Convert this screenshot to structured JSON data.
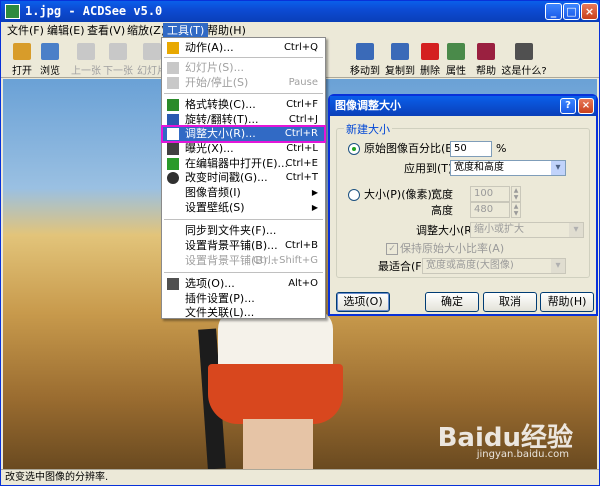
{
  "window": {
    "title": "1.jpg - ACDSee v5.0",
    "buttons": {
      "minimize": "_",
      "maximize": "□",
      "close": "×"
    }
  },
  "menubar": {
    "items": [
      {
        "label": "文件(F)"
      },
      {
        "label": "编辑(E)"
      },
      {
        "label": "查看(V)"
      },
      {
        "label": "缩放(Z)"
      },
      {
        "label": "工具(T)"
      },
      {
        "label": "帮助(H)"
      }
    ]
  },
  "toolbar": {
    "items": [
      {
        "label": "打开",
        "icon": "open-folder-icon",
        "color": "#d89c2a"
      },
      {
        "label": "浏览",
        "icon": "browse-icon",
        "color": "#4a7fc8"
      },
      {
        "label": "上一张",
        "icon": "prev-icon"
      },
      {
        "label": "下一张",
        "icon": "next-icon"
      },
      {
        "label": "幻灯片",
        "icon": "slideshow-icon"
      },
      {
        "label": "移动到",
        "icon": "move-to-icon",
        "color": "#3a6ab8"
      },
      {
        "label": "复制到",
        "icon": "copy-to-icon",
        "color": "#3a6ab8"
      },
      {
        "label": "删除",
        "icon": "delete-icon",
        "color": "#d42020"
      },
      {
        "label": "属性",
        "icon": "properties-icon",
        "color": "#4a8a4a"
      },
      {
        "label": "帮助",
        "icon": "help-book-icon",
        "color": "#9a2040"
      },
      {
        "label": "这是什么?",
        "icon": "whats-this-icon",
        "color": "#505050"
      }
    ]
  },
  "tools_menu": {
    "items": [
      {
        "label": "动作(A)...",
        "shortcut": "Ctrl+Q",
        "icon": "lightning-icon",
        "color": "#e8a800"
      },
      {
        "label": "幻灯片(S)...",
        "shortcut": "",
        "icon": "slideshow-icon",
        "disabled": true
      },
      {
        "label": "开始/停止(S)",
        "shortcut": "Pause",
        "icon": "play-icon",
        "disabled": true
      },
      {
        "label": "格式转换(C)...",
        "shortcut": "Ctrl+F",
        "icon": "convert-icon",
        "color": "#2a8a2a"
      },
      {
        "label": "旋转/翻转(T)...",
        "shortcut": "Ctrl+J",
        "icon": "rotate-icon",
        "color": "#2a5ab0"
      },
      {
        "label": "调整大小(R)...",
        "shortcut": "Ctrl+R",
        "icon": "resize-icon",
        "color": "#ffffff"
      },
      {
        "label": "曝光(X)...",
        "shortcut": "Ctrl+L",
        "icon": "exposure-icon",
        "color": "#404040"
      },
      {
        "label": "在编辑器中打开(E)...",
        "shortcut": "Ctrl+E",
        "icon": "editor-icon",
        "color": "#2a9a2a"
      },
      {
        "label": "改变时间戳(G)...",
        "shortcut": "Ctrl+T",
        "icon": "clock-icon",
        "color": "#303030"
      },
      {
        "label": "图像音频(I)",
        "shortcut": "",
        "submenu": true
      },
      {
        "label": "设置壁纸(S)",
        "shortcut": "",
        "submenu": true
      },
      {
        "label": "同步到文件夹(F)...",
        "shortcut": ""
      },
      {
        "label": "设置背景平铺(B)...",
        "shortcut": "Ctrl+B"
      },
      {
        "label": "设置背景平铺(B)...",
        "shortcut": "Ctrl+Shift+G",
        "disabled": true
      },
      {
        "label": "选项(O)...",
        "shortcut": "Alt+O",
        "icon": "options-icon",
        "color": "#505050"
      },
      {
        "label": "插件设置(P)...",
        "shortcut": ""
      },
      {
        "label": "文件关联(L)...",
        "shortcut": ""
      }
    ]
  },
  "dialog": {
    "title": "图像调整大小",
    "group_title": "新建大小",
    "radio_percent": "原始图像百分比(E):",
    "percent_value": "50",
    "percent_unit": "%",
    "apply_to_label": "应用到(T)",
    "apply_to_value": "宽度和高度",
    "radio_size": "大小(P)(像素):",
    "width_label": "宽度",
    "width_value": "100",
    "height_label": "高度",
    "height_value": "480",
    "resize_label": "调整大小(R)",
    "resize_value": "缩小或扩大",
    "keep_ratio": "保持原始大小比率(A)",
    "best_fit_label": "最适合(F)",
    "best_fit_value": "宽度或高度(大图像)",
    "btn_options": "选项(O)",
    "btn_ok": "确定",
    "btn_cancel": "取消",
    "btn_help": "帮助(H)"
  },
  "statusbar": {
    "text": "改变选中图像的分辨率."
  },
  "watermark": {
    "brand": "Baidu经验",
    "url": "jingyan.baidu.com"
  }
}
